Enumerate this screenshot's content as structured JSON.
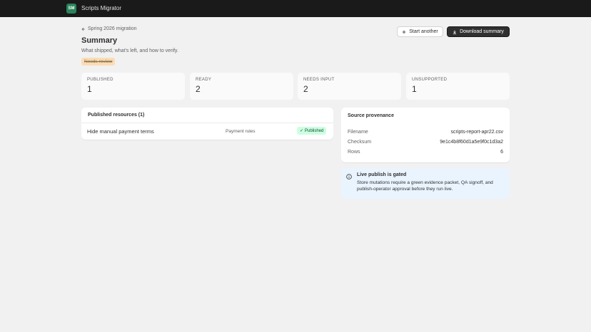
{
  "app": {
    "logo_text": "SM",
    "title": "Scripts Migrator"
  },
  "header": {
    "back_label": "Spring 2026 migration",
    "title": "Summary",
    "subtitle": "What shipped, what's left, and how to verify.",
    "badge": "Needs review",
    "start_another_label": "Start another",
    "download_label": "Download summary"
  },
  "stats": [
    {
      "label": "PUBLISHED",
      "value": "1"
    },
    {
      "label": "READY",
      "value": "2"
    },
    {
      "label": "NEEDS INPUT",
      "value": "2"
    },
    {
      "label": "UNSUPPORTED",
      "value": "1"
    }
  ],
  "resources": {
    "title": "Published resources (1)",
    "rows": [
      {
        "name": "Hide manual payment terms",
        "type": "Payment rules",
        "status": "Published"
      }
    ]
  },
  "provenance": {
    "title": "Source provenance",
    "fields": [
      {
        "label": "Filename",
        "value": "scripts-report-apr22.csv"
      },
      {
        "label": "Checksum",
        "value": "9e1c4b8f60d1a5e9f0c1d3a2"
      },
      {
        "label": "Rows",
        "value": "6"
      }
    ]
  },
  "banner": {
    "title": "Live publish is gated",
    "text": "Store mutations require a green evidence packet, QA signoff, and publish-operator approval before they run live."
  },
  "colors": {
    "topbar": "#1a1a1a",
    "logo": "#29845a",
    "primary_button": "#303030",
    "success_badge": "#cdfee1",
    "info_banner": "#eaf4ff",
    "warning_badge": "#ffd6a4"
  },
  "icons": {
    "back": "arrow-left-icon",
    "add": "plus-icon",
    "download": "download-icon",
    "check": "check-icon",
    "info": "info-icon"
  }
}
